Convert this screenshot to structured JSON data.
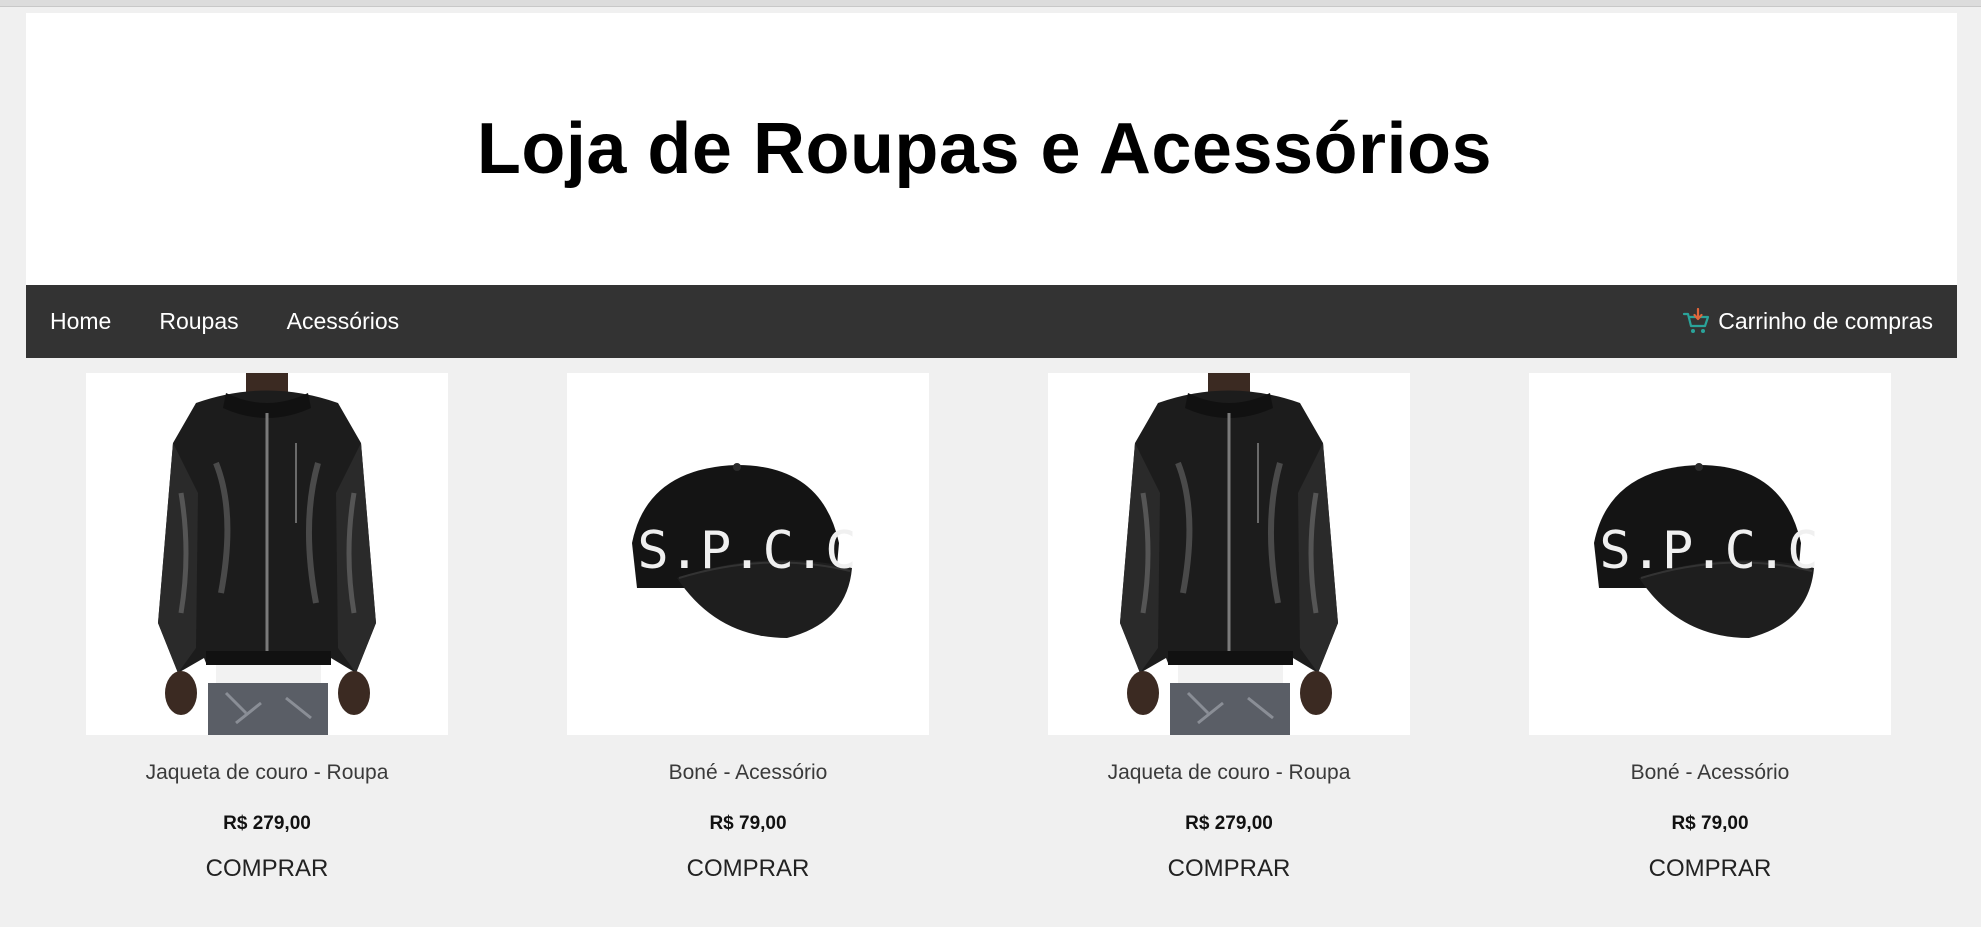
{
  "header": {
    "title": "Loja de Roupas e Acessórios"
  },
  "nav": {
    "items": [
      {
        "label": "Home"
      },
      {
        "label": "Roupas"
      },
      {
        "label": "Acessórios"
      }
    ],
    "cart": {
      "label": "Carrinho de compras",
      "icon": "shopping-cart-icon"
    }
  },
  "products": [
    {
      "name": "Jaqueta de couro - Roupa",
      "price": "R$ 279,00",
      "buy_label": "COMPRAR",
      "image": "leather-jacket"
    },
    {
      "name": "Boné - Acessório",
      "price": "R$ 79,00",
      "buy_label": "COMPRAR",
      "image": "black-cap",
      "cap_text": "S.P.C.C"
    },
    {
      "name": "Jaqueta de couro - Roupa",
      "price": "R$ 279,00",
      "buy_label": "COMPRAR",
      "image": "leather-jacket"
    },
    {
      "name": "Boné - Acessório",
      "price": "R$ 79,00",
      "buy_label": "COMPRAR",
      "image": "black-cap",
      "cap_text": "S.P.C.C"
    }
  ],
  "colors": {
    "navbar": "#333333",
    "background": "#f0f0f0",
    "cart_icon": "#2aa39a"
  }
}
